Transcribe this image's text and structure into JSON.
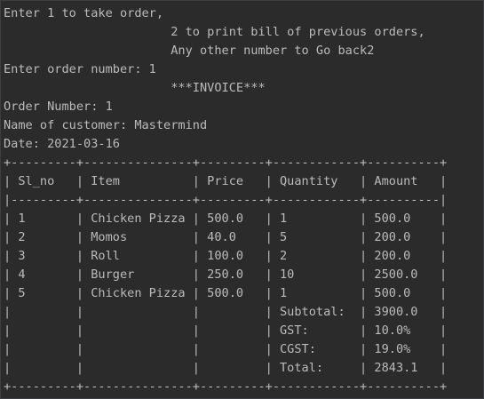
{
  "console": {
    "lines": [
      "Enter 1 to take order,",
      "                       2 to print bill of previous orders,",
      "                       Any other number to Go back2",
      "Enter order number: 1",
      "                       ***INVOICE***",
      "Order Number: 1",
      "Name of customer: Mastermind",
      "Date: 2021-03-16",
      "+---------+---------------+---------+------------+----------+",
      "| Sl_no   | Item          | Price   | Quantity   | Amount   |",
      "|---------+---------------+---------+------------+----------|",
      "| 1       | Chicken Pizza | 500.0   | 1          | 500.0    |",
      "| 2       | Momos         | 40.0    | 5          | 200.0    |",
      "| 3       | Roll          | 100.0   | 2          | 200.0    |",
      "| 4       | Burger        | 250.0   | 10         | 2500.0   |",
      "| 5       | Chicken Pizza | 500.0   | 1          | 500.0    |",
      "|         |               |         | Subtotal:  | 3900.0   |",
      "|         |               |         | GST:       | 10.0%    |",
      "|         |               |         | CGST:      | 19.0%    |",
      "|         |               |         | Total:     | 2843.1   |",
      "+---------+---------------+---------+------------+----------+"
    ]
  }
}
